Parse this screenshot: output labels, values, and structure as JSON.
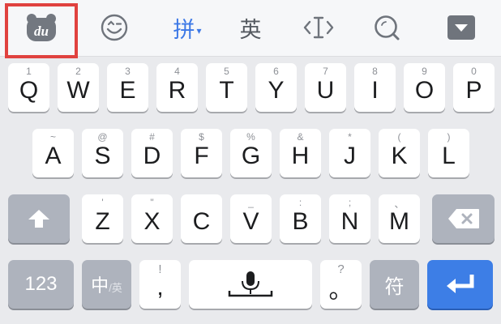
{
  "toolbar": {
    "logo_text": "du",
    "pinyin_label": "拼",
    "pinyin_caret": "▾",
    "english_label": "英"
  },
  "keyboard": {
    "row1": [
      {
        "alt": "1",
        "main": "Q"
      },
      {
        "alt": "2",
        "main": "W"
      },
      {
        "alt": "3",
        "main": "E"
      },
      {
        "alt": "4",
        "main": "R"
      },
      {
        "alt": "5",
        "main": "T"
      },
      {
        "alt": "6",
        "main": "Y"
      },
      {
        "alt": "7",
        "main": "U"
      },
      {
        "alt": "8",
        "main": "I"
      },
      {
        "alt": "9",
        "main": "O"
      },
      {
        "alt": "0",
        "main": "P"
      }
    ],
    "row2": [
      {
        "alt": "~",
        "main": "A"
      },
      {
        "alt": "@",
        "main": "S"
      },
      {
        "alt": "#",
        "main": "D"
      },
      {
        "alt": "$",
        "main": "F"
      },
      {
        "alt": "%",
        "main": "G"
      },
      {
        "alt": "&",
        "main": "H"
      },
      {
        "alt": "*",
        "main": "J"
      },
      {
        "alt": "(",
        "main": "K"
      },
      {
        "alt": ")",
        "main": "L"
      }
    ],
    "row3": [
      {
        "alt": "'",
        "main": "Z"
      },
      {
        "alt": "\"",
        "main": "X"
      },
      {
        "alt": "",
        "main": "C"
      },
      {
        "alt": "_",
        "main": "V"
      },
      {
        "alt": ":",
        "main": "B"
      },
      {
        "alt": ";",
        "main": "N"
      },
      {
        "alt": "、",
        "main": "M"
      }
    ],
    "numbers_label": "123",
    "lang_main": "中",
    "lang_sub": "/英",
    "comma_alt": "!",
    "comma_main": ",",
    "period_alt": "?",
    "period_main": "。",
    "symbol_label": "符"
  },
  "colors": {
    "highlight": "#e0423f",
    "accent": "#3d7ee6",
    "pinyin_active": "#3c78e6"
  },
  "icons": {
    "logo": "baidu-du-bear-icon",
    "emoji": "smiley-icon",
    "cursor": "cursor-move-icon",
    "search": "search-icon",
    "hide": "hide-keyboard-icon",
    "shift": "shift-up-arrow-icon",
    "delete": "backspace-icon",
    "voice": "microphone-icon",
    "enter": "return-arrow-icon"
  }
}
